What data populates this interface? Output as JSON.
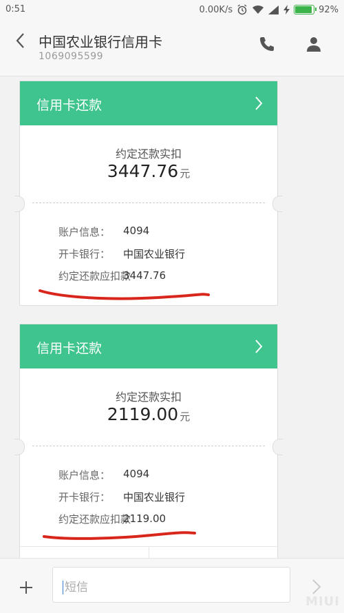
{
  "status_bar": {
    "time": "0:51",
    "network_speed": "0.00K/s",
    "battery_percent": "92%",
    "battery_level": 0.92,
    "icons": [
      "alarm-icon",
      "wifi-icon",
      "signal-icon",
      "charging-icon",
      "battery-icon"
    ]
  },
  "header": {
    "title": "中国农业银行信用卡",
    "subtitle": "1069095599",
    "icons": [
      "back-arrow-icon",
      "phone-icon",
      "contact-icon"
    ]
  },
  "messages": [
    {
      "card_title": "信用卡还款",
      "amount_label": "约定还款实扣",
      "amount": "3447.76",
      "unit": "元",
      "account_label": "账户信息：",
      "account_value": "4094",
      "bank_label": "开卡银行：",
      "bank_value": "中国农业银行",
      "due_label": "约定还款应扣款",
      "due_value": "3447.76"
    },
    {
      "card_title": "信用卡还款",
      "amount_label": "约定还款实扣",
      "amount": "2119.00",
      "unit": "元",
      "account_label": "账户信息：",
      "account_value": "4094",
      "bank_label": "开卡银行：",
      "bank_value": "中国农业银行",
      "due_label": "约定还款应扣款",
      "due_value": "2119.00"
    }
  ],
  "composer": {
    "placeholder": "短信",
    "icons": [
      "plus-icon",
      "send-icon"
    ]
  },
  "watermark": "MIUI",
  "colors": {
    "card_header": "#3ec48c",
    "annotation": "#d9261c",
    "battery": "#3cb24a"
  }
}
